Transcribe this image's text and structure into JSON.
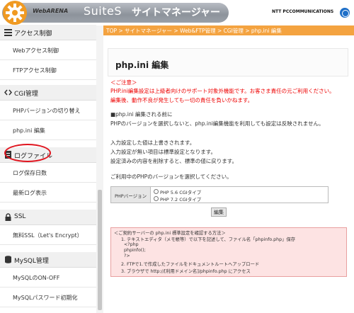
{
  "header": {
    "brand": "WebARENA",
    "product": "SuiteS",
    "title": "サイトマネージャー",
    "ntt": "NTT PCCOMMUNICATIONS"
  },
  "sidebar": {
    "sections": [
      {
        "label": "アクセス制御",
        "icon": "list-icon"
      },
      {
        "label": "CGI管理",
        "icon": "code-icon"
      },
      {
        "label": "ログファイル",
        "icon": "file-icon"
      },
      {
        "label": "SSL",
        "icon": "lock-icon"
      },
      {
        "label": "MySQL管理",
        "icon": "database-icon"
      }
    ],
    "items": [
      {
        "label": "Webアクセス制御"
      },
      {
        "label": "FTPアクセス制御"
      },
      {
        "label": "PHPバージョンの切り替え"
      },
      {
        "label": "php.ini 編集"
      },
      {
        "label": "ログ保存日数"
      },
      {
        "label": "最新ログ表示"
      },
      {
        "label": "無料SSL（Let's Encrypt）"
      },
      {
        "label": "MySQLのON-OFF"
      },
      {
        "label": "MySQLパスワード初期化"
      }
    ]
  },
  "breadcrumb": "TOP > サイトマネージャー > Web&FTP管理 > CGI管理 > php.ini 編集",
  "main": {
    "title": "php.ini 編集",
    "caution_head": "＜ご注意＞",
    "caution_1": "PHP.ini編集設定は上級者向けのサポート対象外機能です。お客さま責任の元ご利用ください。",
    "caution_2": "編集後、動作不良が発生しても一切の責任を負いかねます。",
    "notes": [
      "■php.ini 編集される前に",
      "PHPのバージョンを選択しないと、php.ini編集機能を利用しても設定は反映されません。",
      "入力設定した値は上書きされます。",
      "入力設定が無い項目は標準設定となります。",
      "設定済みの内容を削除すると、標準の値に戻ります。",
      "ご利用中のPHPのバージョンを選択してください。"
    ],
    "version_label": "PHPバージョン",
    "options": [
      "PHP 5.6 CGIタイプ",
      "PHP 7.2 CGIタイプ"
    ],
    "edit_button": "編集",
    "howto": [
      "＜ご契約サーバーの php.ini 標準設定を確認する方法＞",
      "1. テキストエディタ（メモ帳等）で以下を記述して、ファイル名「phpinfo.php」保存",
      "<?php",
      "phpinfo();",
      "?>",
      "2. FTPで1.で作成したファイルをドキュメントルートへアップロード",
      "3. ブラウザで http://[利用ドメイン名]/phpinfo.php にアクセス"
    ]
  },
  "colors": {
    "breadcrumb": "#f4a340",
    "warning": "#e00000",
    "highlight": "#e0141e",
    "howto_bg": "#fde3e3"
  }
}
